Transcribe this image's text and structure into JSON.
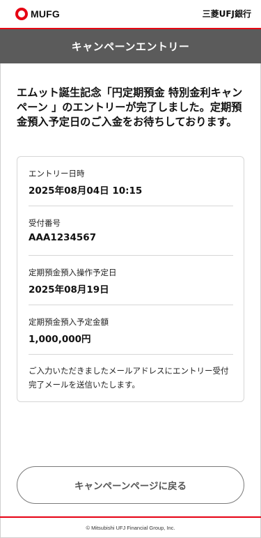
{
  "header": {
    "logo_text": "MUFG",
    "bank_name": "三菱UFJ銀行"
  },
  "title_bar": {
    "title": "キャンペーンエントリー"
  },
  "message": "エムット誕生記念「円定期預金 特別金利キャンペーン 」のエントリーが完了しました。定期預金預入予定日のご入金をお待ちしております。",
  "details": {
    "entry_datetime": {
      "label": "エントリー日時",
      "value": "2025年08月04日 10:15"
    },
    "reference_number": {
      "label": "受付番号",
      "value": "AAA1234567"
    },
    "scheduled_date": {
      "label": "定期預金預入操作予定日",
      "value": "2025年08月19日"
    },
    "scheduled_amount": {
      "label": "定期預金預入予定金額",
      "value": "1,000,000円"
    },
    "note": "ご入力いただきましたメールアドレスにエントリー受付完了メールを送信いたします。"
  },
  "back_button": {
    "label": "キャンペーンページに戻る"
  },
  "footer": {
    "copyright": "© Mitsubishi UFJ Financial Group, Inc."
  },
  "colors": {
    "brand_red": "#e60012",
    "title_bar_bg": "#5b5b5b",
    "border": "#d6d6d6"
  },
  "icons": {
    "logo_mark": "mufg-logo-icon"
  }
}
